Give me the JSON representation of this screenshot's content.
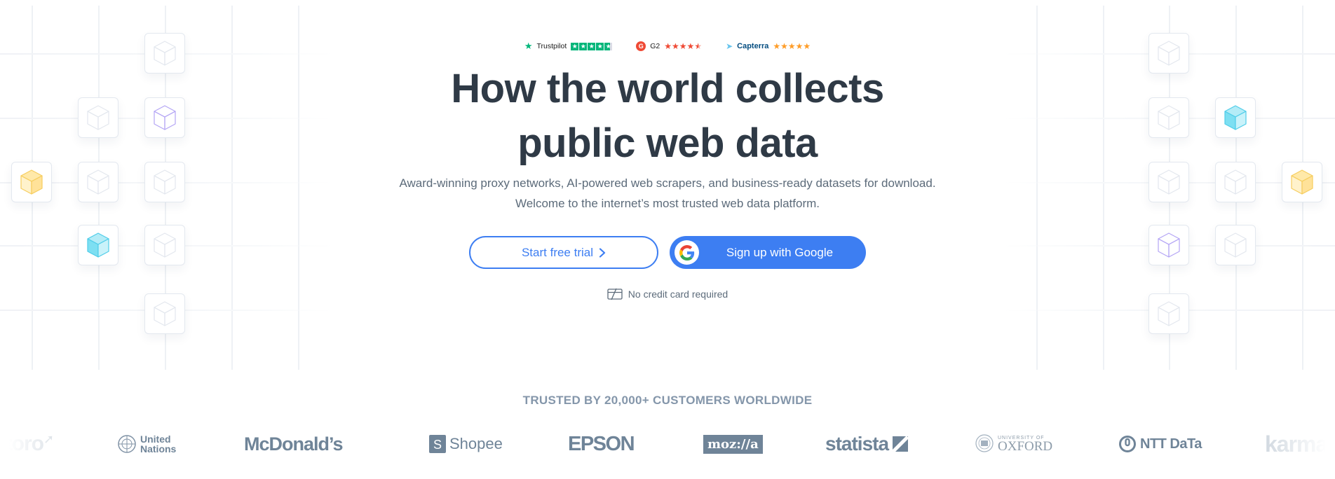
{
  "ratings": [
    {
      "name": "Trustpilot",
      "stars": 5,
      "color": "#00b67a"
    },
    {
      "name": "G2",
      "stars": 4.5,
      "color": "#ef4a35"
    },
    {
      "name": "Capterra",
      "stars": 5,
      "color": "#ff9d28"
    }
  ],
  "hero": {
    "title_line1": "How the world collects",
    "title_line2": "public web data",
    "subtitle_line1": "Award-winning proxy networks, AI-powered web scrapers, and business-ready datasets for download.",
    "subtitle_line2": "Welcome to the internet’s most trusted web data platform."
  },
  "cta": {
    "trial_label": "Start free trial",
    "trial_icon": "chevron-right-icon",
    "google_label": "Sign up with Google",
    "google_icon": "google-g-icon",
    "no_cc_label": "No credit card required",
    "no_cc_icon": "no-credit-card-icon",
    "accent": "#3d7ef2"
  },
  "trusted": {
    "heading": "TRUSTED BY 20,000+ CUSTOMERS WORLDWIDE",
    "logos": [
      "eToro",
      "United Nations",
      "McDonald's",
      "Shopee",
      "EPSON",
      "moz://a",
      "statista",
      "University of Oxford",
      "NTT DATA",
      "karma"
    ]
  },
  "decor": {
    "cube_colors": {
      "gray": "#e3e7ee",
      "purple": "#b4a5f5",
      "cyan": "#6fd6ee",
      "yellow": "#fcd978"
    }
  }
}
